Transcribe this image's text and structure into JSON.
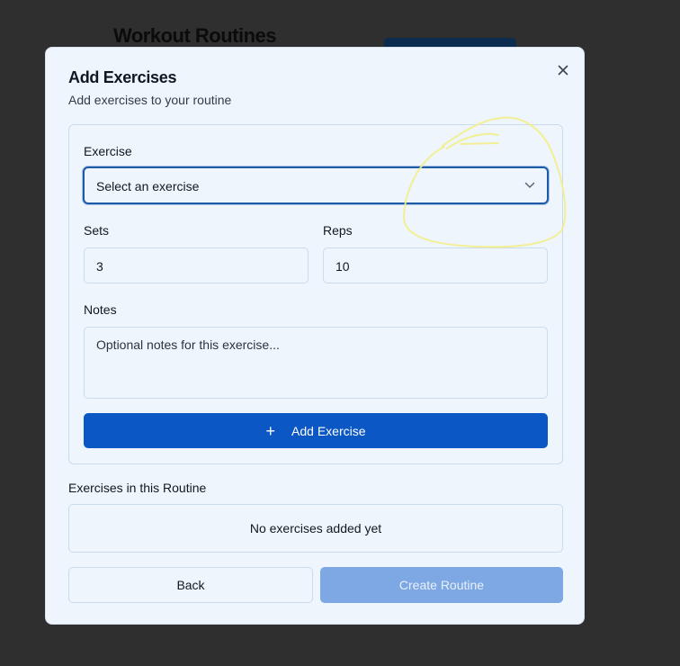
{
  "background": {
    "page_title": "Workout Routines"
  },
  "modal": {
    "title": "Add Exercises",
    "subtitle": "Add exercises to your routine",
    "close_icon": "close-icon"
  },
  "form": {
    "exercise_label": "Exercise",
    "exercise_selected": "Select an exercise",
    "sets_label": "Sets",
    "sets_value": "3",
    "reps_label": "Reps",
    "reps_value": "10",
    "notes_label": "Notes",
    "notes_placeholder": "Optional notes for this exercise...",
    "add_button_icon": "+",
    "add_button_label": "Add Exercise"
  },
  "routine": {
    "section_label": "Exercises in this Routine",
    "empty_text": "No exercises added yet"
  },
  "footer": {
    "back_label": "Back",
    "create_label": "Create Routine"
  },
  "colors": {
    "primary": "#0b57c4",
    "primary_disabled": "#7ea8e3",
    "modal_bg": "#eef5fc",
    "annotation": "#f2ee8a"
  }
}
